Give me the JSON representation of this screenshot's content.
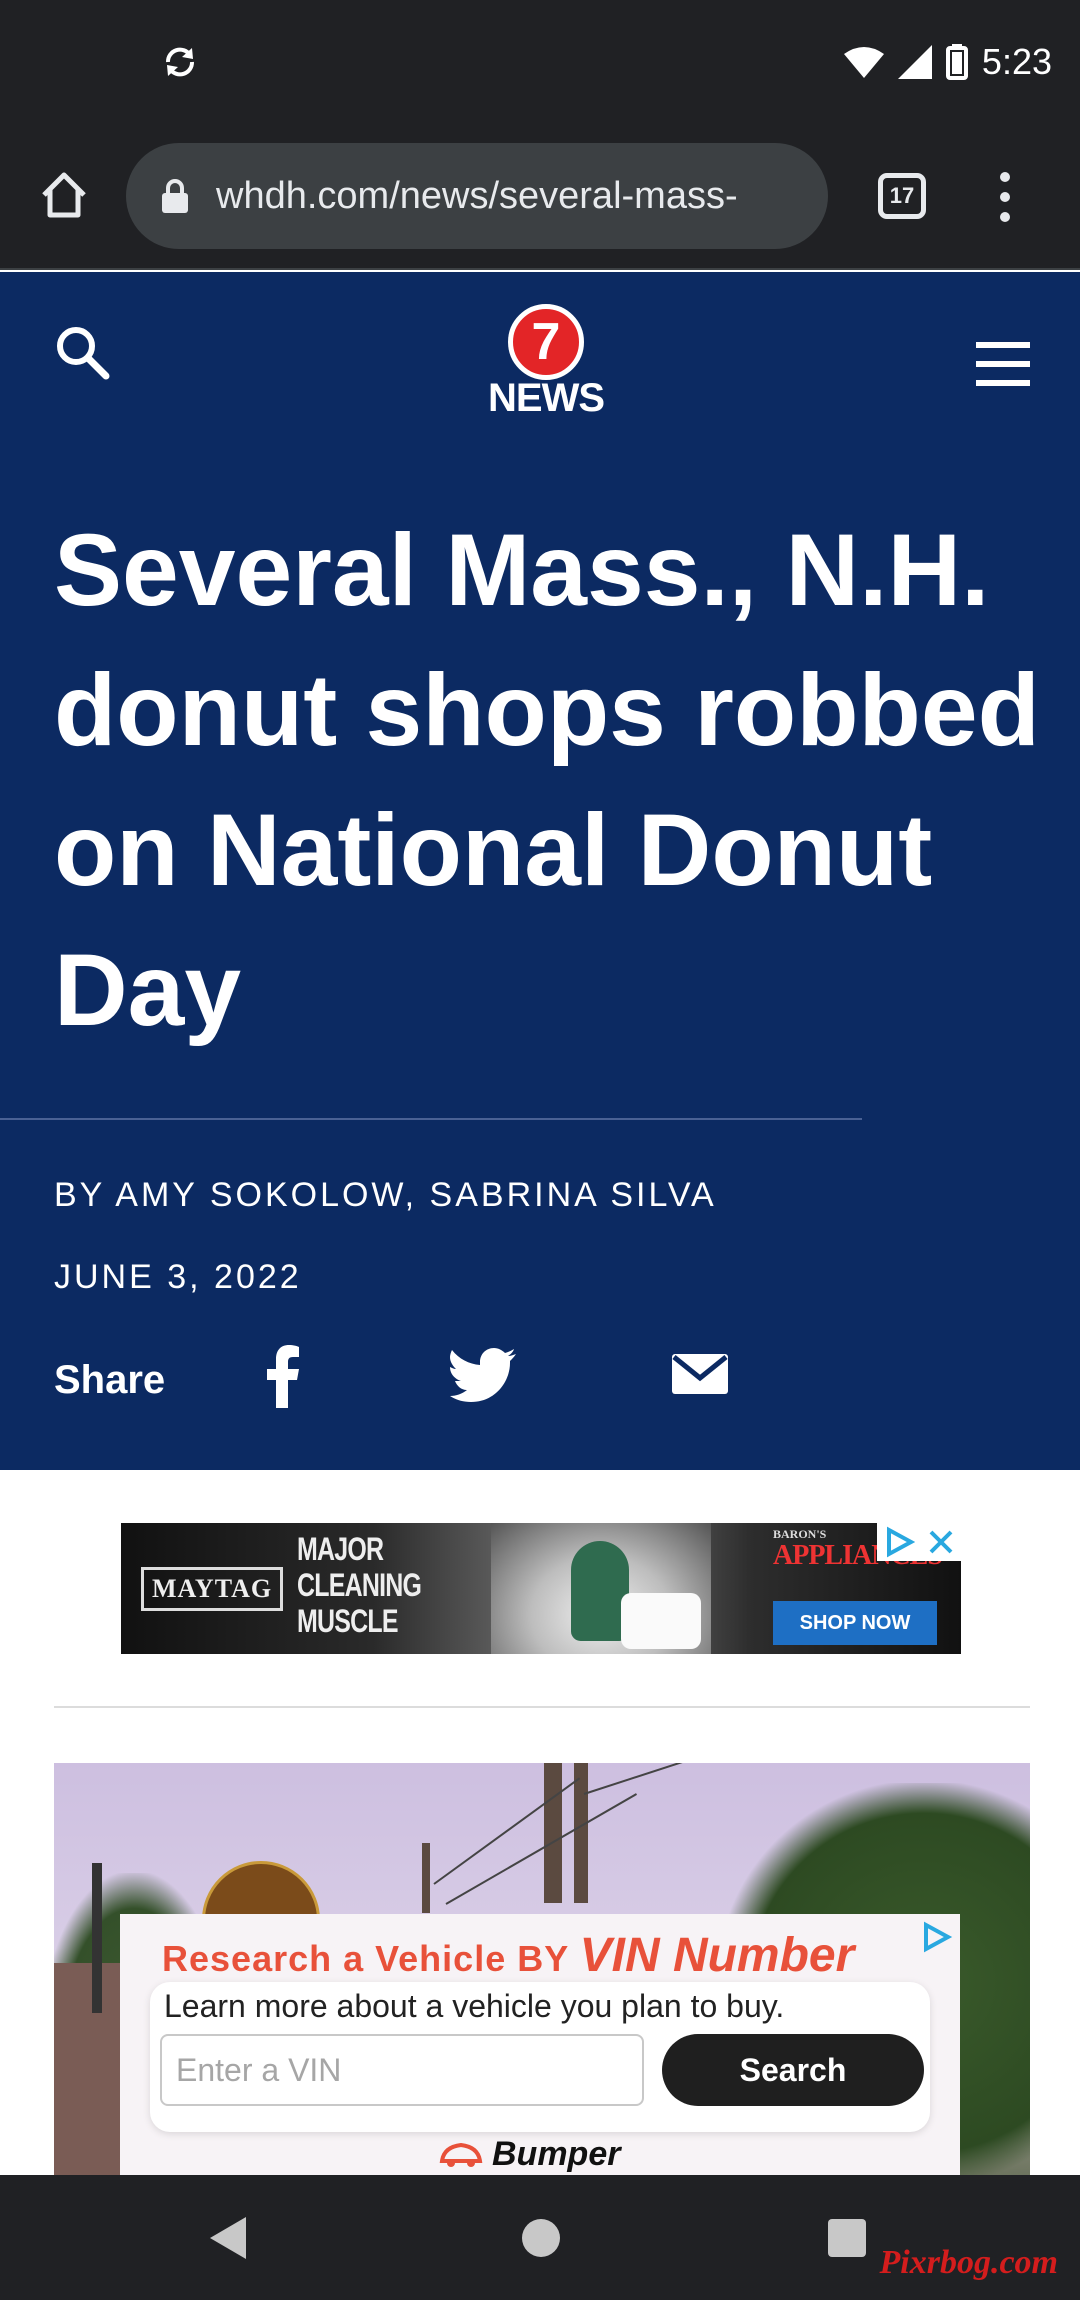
{
  "status_bar": {
    "time": "5:23",
    "icons": [
      "sync-icon",
      "wifi-icon",
      "signal-icon",
      "battery-icon"
    ]
  },
  "browser": {
    "url": "whdh.com/news/several-mass-",
    "tab_count": "17",
    "icons": [
      "home-icon",
      "lock-icon",
      "tabs-icon",
      "more-vert-icon"
    ]
  },
  "site": {
    "logo_number": "7",
    "logo_text": "NEWS",
    "brand_color": "#0c2a62",
    "logo_color": "#e32527",
    "icons": [
      "search-icon",
      "menu-icon"
    ]
  },
  "article": {
    "headline": "Several Mass., N.H. donut shops robbed on National Donut Day",
    "byline": "BY AMY SOKOLOW, SABRINA SILVA",
    "date": "JUNE 3, 2022",
    "share_label": "Share",
    "share_icons": [
      "facebook-icon",
      "twitter-icon",
      "email-icon"
    ]
  },
  "banner_ad": {
    "brand": "MAYTAG",
    "tagline_lines": [
      "MAJOR",
      "CLEANING",
      "MUSCLE"
    ],
    "retailer_small": "BARON'S",
    "retailer": "APPLIANCES",
    "cta": "SHOP NOW"
  },
  "vin_ad": {
    "title_prefix": "Research a Vehicle BY",
    "title_emphasis": "VIN Number",
    "description": "Learn more about a vehicle you plan to buy.",
    "input_placeholder": "Enter a VIN",
    "button_label": "Search",
    "brand": "Bumper",
    "accent_color": "#e8513a"
  },
  "nav_bar": {
    "icons": [
      "back-icon",
      "home-icon",
      "recents-icon"
    ]
  },
  "watermark": "Pixrbog.com"
}
